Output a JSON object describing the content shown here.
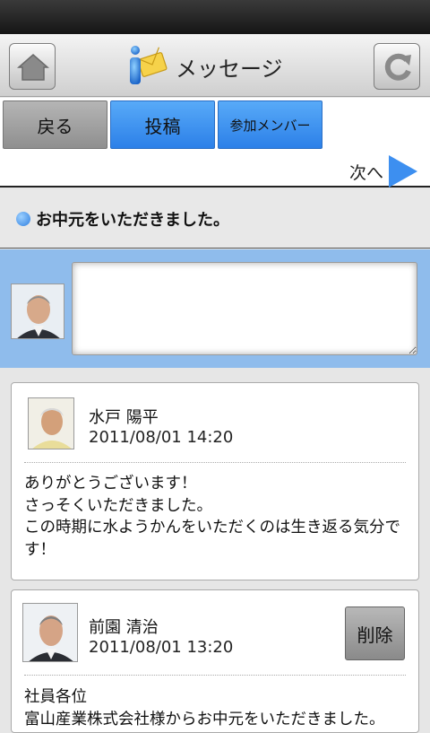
{
  "header": {
    "title": "メッセージ",
    "home_icon": "home-icon",
    "reload_icon": "reload-icon",
    "app_icon": "message-info-icon"
  },
  "toolbar": {
    "back_label": "戻る",
    "post_label": "投稿",
    "members_label": "参加メンバー",
    "next_label": "次へ"
  },
  "topic": {
    "title": "お中元をいただきました。"
  },
  "composer": {
    "placeholder": ""
  },
  "messages": [
    {
      "author": "水戸 陽平",
      "time": "2011/08/01 14:20",
      "body": "ありがとうございます！\nさっそくいただきました。\nこの時期に水ようかんをいただくのは生き返る気分です！",
      "can_delete": false
    },
    {
      "author": "前園 清治",
      "time": "2011/08/01 13:20",
      "body": "社員各位\n富山産業株式会社様からお中元をいただきました。",
      "delete_label": "削除",
      "can_delete": true
    }
  ],
  "colors": {
    "accent_blue": "#3d8ff0",
    "composer_bg": "#8fbcec",
    "gray_button": "#a2a2a2"
  }
}
